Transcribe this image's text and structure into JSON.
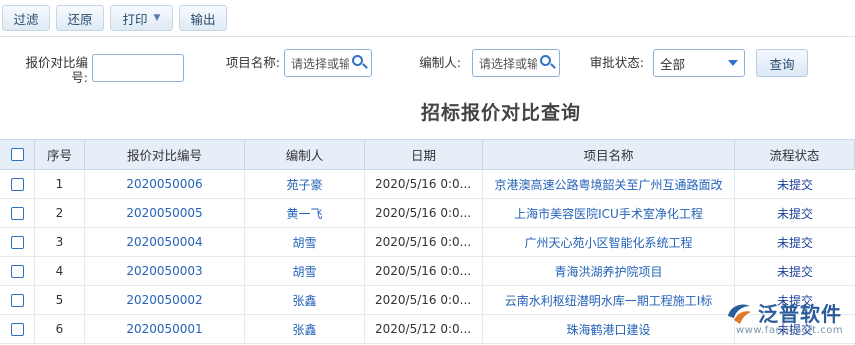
{
  "toolbar": {
    "filter_label": "过滤",
    "restore_label": "还原",
    "print_label": "打印",
    "export_label": "输出"
  },
  "filters": {
    "code_label": "报价对比编号:",
    "code_value": "",
    "project_label": "项目名称:",
    "project_placeholder": "请选择或输",
    "author_label": "编制人:",
    "author_placeholder": "请选择或输",
    "status_label": "审批状态:",
    "status_value": "全部",
    "query_label": "查询"
  },
  "page_title": "招标报价对比查询",
  "table": {
    "headers": {
      "no": "序号",
      "code": "报价对比编号",
      "author": "编制人",
      "date": "日期",
      "project": "项目名称",
      "status": "流程状态"
    },
    "rows": [
      {
        "no": "1",
        "code": "2020050006",
        "author": "苑子豪",
        "date": "2020/5/16 0:0...",
        "project": "京港澳高速公路粤境韶关至广州互通路面改",
        "status": "未提交"
      },
      {
        "no": "2",
        "code": "2020050005",
        "author": "黄一飞",
        "date": "2020/5/16 0:0...",
        "project": "上海市美容医院ICU手术室净化工程",
        "status": "未提交"
      },
      {
        "no": "3",
        "code": "2020050004",
        "author": "胡雪",
        "date": "2020/5/16 0:0...",
        "project": "广州天心苑小区智能化系统工程",
        "status": "未提交"
      },
      {
        "no": "4",
        "code": "2020050003",
        "author": "胡雪",
        "date": "2020/5/16 0:0...",
        "project": "青海洪湖养护院项目",
        "status": "未提交"
      },
      {
        "no": "5",
        "code": "2020050002",
        "author": "张鑫",
        "date": "2020/5/16 0:0...",
        "project": "云南水利枢纽潜明水库一期工程施工I标",
        "status": "未提交"
      },
      {
        "no": "6",
        "code": "2020050001",
        "author": "张鑫",
        "date": "2020/5/12 0:0...",
        "project": "珠海鹤港口建设",
        "status": "未提交"
      }
    ]
  },
  "watermark": {
    "brand": "泛普软件",
    "url": "www.fanpusoft.com"
  },
  "colors": {
    "link": "#2563b8",
    "status": "#1a3f9a",
    "header_bg": "#e6eff8",
    "accent": "#2f73c9"
  }
}
